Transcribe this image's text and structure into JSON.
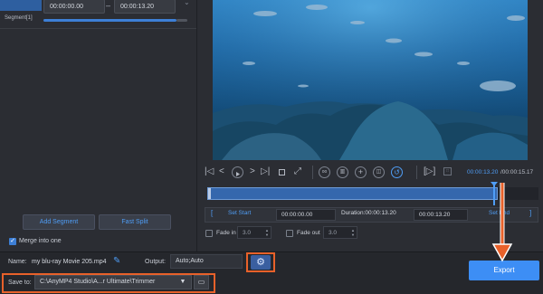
{
  "segment": {
    "start": "00:00:00.00",
    "dash": "–",
    "end": "00:00:13.20",
    "label": "Segment[1]"
  },
  "left": {
    "add_segment": "Add Segment",
    "fast_split": "Fast Split",
    "merge_label": "Merge into one",
    "merge_checked": true
  },
  "player": {
    "time_current": "00:00:13.20",
    "time_total": "/00:00:15.17",
    "progress": 0.87
  },
  "range": {
    "set_start": "Set Start",
    "start": "00:00:00.00",
    "duration": "Duration:00:00:13.20",
    "end": "00:00:13.20",
    "set_end": "Set End",
    "bracket_left": "[",
    "bracket_right": "]"
  },
  "fade": {
    "fade_in_label": "Fade in",
    "fade_in_value": "3.0",
    "fade_out_label": "Fade out",
    "fade_out_value": "3.0"
  },
  "output": {
    "name_label": "Name:",
    "name_value": "my blu-ray Movie 205.mp4",
    "output_label": "Output:",
    "output_value": "Auto;Auto",
    "saveto_label": "Save to:",
    "saveto_value": "C:\\AnyMP4 Studio\\A...r Ultimate\\Trimmer",
    "export_label": "Export"
  },
  "colors": {
    "accent": "#3d8ef5",
    "highlight": "#e8612a",
    "background": "#2b2d33"
  },
  "icons": [
    "chevron-down-icon",
    "skip-start-icon",
    "prev-frame-icon",
    "play-icon",
    "next-frame-icon",
    "skip-end-icon",
    "stop-icon",
    "loop-icon",
    "copy-icon",
    "add-icon",
    "split-icon",
    "rotate-icon",
    "preview-icon",
    "pencil-icon",
    "gear-icon",
    "dropdown-icon",
    "folder-icon"
  ]
}
